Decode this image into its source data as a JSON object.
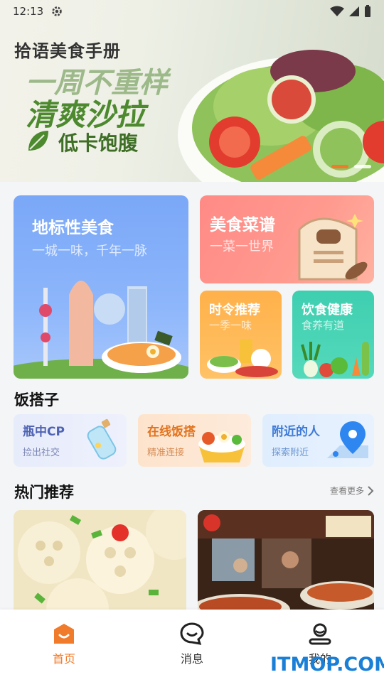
{
  "status_bar": {
    "time": "12:13",
    "icons": [
      "settings-icon",
      "wifi-icon",
      "signal-icon",
      "battery-icon"
    ]
  },
  "banner": {
    "title": "拾语美食手册",
    "line1": "一周不重样",
    "line2": "清爽沙拉",
    "line3": "低卡饱腹",
    "slide_count": 2,
    "active_slide": 1
  },
  "features": {
    "landmark": {
      "title": "地标性美食",
      "subtitle": "一城一味，千年一脉"
    },
    "recipe": {
      "title": "美食菜谱",
      "subtitle": "一菜一世界"
    },
    "season": {
      "title": "时令推荐",
      "subtitle": "一季一味"
    },
    "health": {
      "title": "饮食健康",
      "subtitle": "食养有道"
    }
  },
  "buddy_section": {
    "title": "饭搭子",
    "cards": [
      {
        "title": "瓶中CP",
        "subtitle": "捡出社交",
        "icon": "bottle-icon"
      },
      {
        "title": "在线饭搭",
        "subtitle": "精准连接",
        "icon": "food-box-icon"
      },
      {
        "title": "附近的人",
        "subtitle": "探索附近",
        "icon": "location-pin-icon"
      }
    ]
  },
  "hot_section": {
    "title": "热门推荐",
    "more_label": "查看更多"
  },
  "bottom_nav": [
    {
      "label": "首页",
      "icon": "home-icon",
      "active": true
    },
    {
      "label": "消息",
      "icon": "message-icon",
      "active": false
    },
    {
      "label": "我的",
      "icon": "profile-icon",
      "active": false
    }
  ],
  "watermark": "ITMOP.COM",
  "colors": {
    "accent": "#f07b2a",
    "landmark": "#7aa7f7",
    "recipe": "#ff8a86",
    "season": "#ffb14a",
    "health": "#3ecfb0"
  }
}
